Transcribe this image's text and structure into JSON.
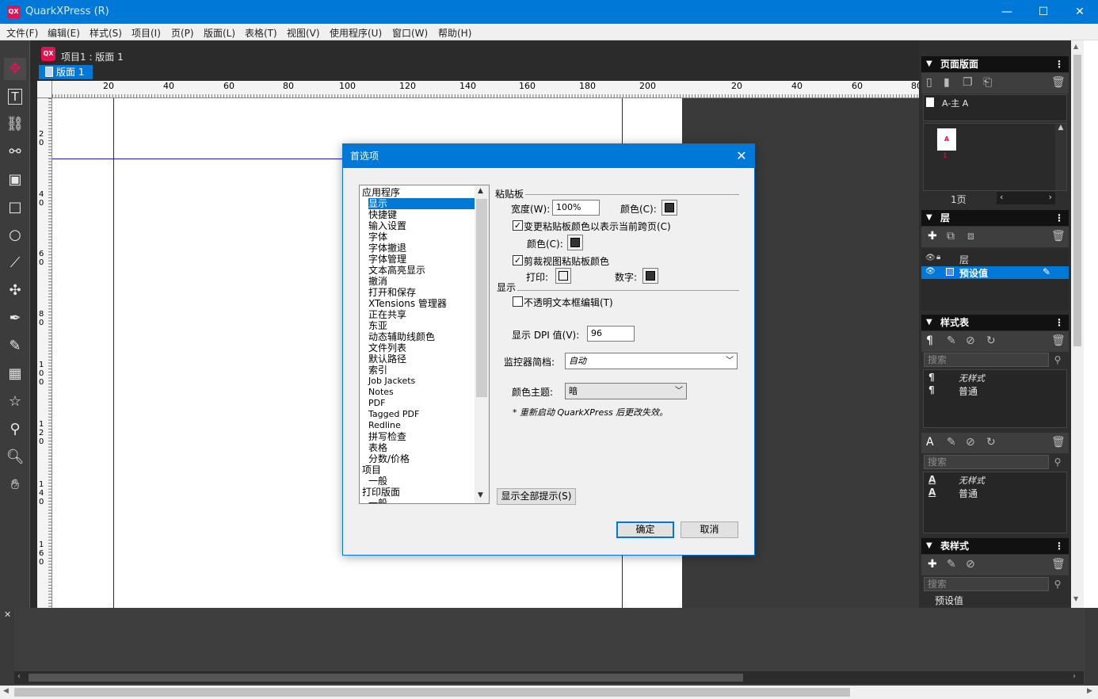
{
  "window": {
    "app_icon": "QX",
    "title": "QuarkXPress (R)",
    "minimize": "—",
    "maximize": "☐",
    "close": "✕"
  },
  "menu": [
    "文件(F)",
    "编辑(E)",
    "样式(S)",
    "项目(I)",
    "页(P)",
    "版面(L)",
    "表格(T)",
    "视图(V)",
    "使用程序(U)",
    "窗口(W)",
    "帮助(H)"
  ],
  "tools": [
    "move-icon",
    "text-icon",
    "link-icon",
    "unlink-icon",
    "picture-box-icon",
    "rectangle-icon",
    "ellipse-icon",
    "line-icon",
    "scissors-icon",
    "pen-icon",
    "pencil-icon",
    "table-icon",
    "star-icon",
    "eyedropper-icon",
    "zoom-icon",
    "hand-icon"
  ],
  "document": {
    "tab_label": "项目1 : 版面 1",
    "layout_tab": "版面 1"
  },
  "ruler": {
    "h_labels": [
      "20",
      "40",
      "60",
      "80",
      "100",
      "120",
      "140",
      "160",
      "180",
      "200",
      "20",
      "40",
      "60",
      "80"
    ],
    "v_labels": [
      "2 0",
      "4 0",
      "6 0",
      "8 0",
      "1 0 0",
      "1 2 0",
      "1 4 0",
      "1 6 0"
    ]
  },
  "panels": {
    "page_layout": {
      "title": "页面版面",
      "master": "A-主 A",
      "thumb_letter": "A",
      "thumb_num": "1",
      "page_count": "1页"
    },
    "layers": {
      "title": "层",
      "header": "层",
      "layer_name": "预设值"
    },
    "style_sheets": {
      "title": "样式表",
      "search_placeholder": "搜索",
      "para_items": [
        "无样式",
        "普通"
      ],
      "char_search_placeholder": "搜索",
      "char_items": [
        "无样式",
        "普通"
      ]
    },
    "table_styles": {
      "title": "表样式",
      "search_placeholder": "搜索",
      "item": "预设值"
    }
  },
  "dialog": {
    "title": "首选项",
    "categories": [
      {
        "label": "应用程序",
        "level": 1
      },
      {
        "label": "显示",
        "level": 2,
        "selected": true
      },
      {
        "label": "快捷键",
        "level": 2
      },
      {
        "label": "输入设置",
        "level": 2
      },
      {
        "label": "字体",
        "level": 2
      },
      {
        "label": "字体撤退",
        "level": 2
      },
      {
        "label": "字体管理",
        "level": 2
      },
      {
        "label": "文本高亮显示",
        "level": 2
      },
      {
        "label": "撤消",
        "level": 2
      },
      {
        "label": "打开和保存",
        "level": 2
      },
      {
        "label": "XTensions 管理器",
        "level": 2
      },
      {
        "label": "正在共享",
        "level": 2
      },
      {
        "label": "东亚",
        "level": 2
      },
      {
        "label": "动态辅助线颜色",
        "level": 2
      },
      {
        "label": "文件列表",
        "level": 2
      },
      {
        "label": "默认路径",
        "level": 2
      },
      {
        "label": "索引",
        "level": 2
      },
      {
        "label": "Job Jackets",
        "level": 2
      },
      {
        "label": "Notes",
        "level": 2
      },
      {
        "label": "PDF",
        "level": 2
      },
      {
        "label": "Tagged PDF",
        "level": 2
      },
      {
        "label": "Redline",
        "level": 2
      },
      {
        "label": "拼写检查",
        "level": 2
      },
      {
        "label": "表格",
        "level": 2
      },
      {
        "label": "分数/价格",
        "level": 2
      },
      {
        "label": "项目",
        "level": 1
      },
      {
        "label": "一般",
        "level": 2
      },
      {
        "label": "打印版面",
        "level": 1
      },
      {
        "label": "一般",
        "level": 2
      }
    ],
    "pasteboard": {
      "section": "粘贴板",
      "width_label": "宽度(W):",
      "width_value": "100%",
      "color_label": "颜色(C):",
      "change_color_label": "变更粘贴板颜色以表示当前跨页(C)",
      "change_color_checked": true,
      "color2_label": "颜色(C):",
      "clip_label": "剪裁视图粘贴板颜色",
      "clip_checked": true,
      "print_label": "打印:",
      "number_label": "数字:"
    },
    "display": {
      "section": "显示",
      "opaque_label": "不透明文本框编辑(T)",
      "opaque_checked": false,
      "dpi_label": "显示 DPI 值(V):",
      "dpi_value": "96",
      "monitor_label": "监控器简档:",
      "monitor_value": "自动",
      "theme_label": "颜色主题:",
      "theme_value": "暗",
      "note": "* 重新启动 QuarkXPress 后更改失效。"
    },
    "show_all_tips": "显示全部提示(S)",
    "ok": "确定",
    "cancel": "取消"
  },
  "colors": {
    "accent": "#0078d7",
    "panel_bg": "#2e2e2e",
    "toolbar_bg": "#3c3c3c",
    "quark_red": "#e3124f"
  }
}
